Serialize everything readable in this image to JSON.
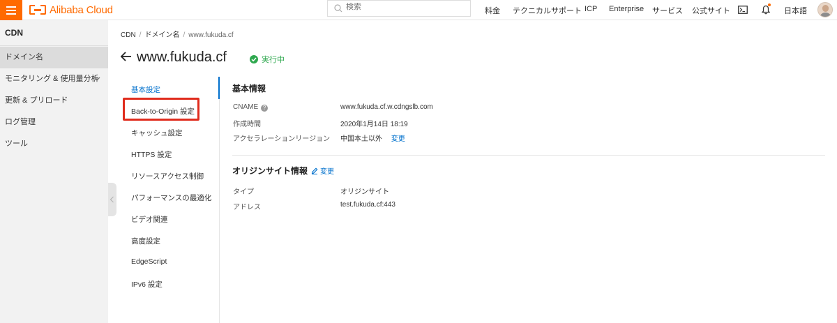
{
  "topbar": {
    "brand": "Alibaba Cloud",
    "search_placeholder": "検索",
    "nav": [
      "料金",
      "テクニカルサポート",
      "ICP",
      "Enterprise",
      "サービス",
      "公式サイト"
    ],
    "language": "日本語",
    "icons": [
      "menu-icon",
      "search-icon",
      "terminal-icon",
      "bell-icon",
      "avatar"
    ],
    "accent_color": "#ff6a00"
  },
  "sidebar": {
    "title": "CDN",
    "items": [
      {
        "label": "ドメイン名",
        "active": true
      },
      {
        "label": "モニタリング & 使用量分析",
        "expandable": true
      },
      {
        "label": "更新 & プリロード"
      },
      {
        "label": "ログ管理"
      },
      {
        "label": "ツール"
      }
    ]
  },
  "breadcrumb": [
    "CDN",
    "ドメイン名",
    "www.fukuda.cf"
  ],
  "page": {
    "title": "www.fukuda.cf",
    "status": "実行中",
    "status_color": "#2fa84f"
  },
  "subnav": {
    "tabs": [
      "基本設定",
      "Back-to-Origin 設定",
      "キャッシュ設定",
      "HTTPS 設定",
      "リソースアクセス制御",
      "パフォーマンスの最適化",
      "ビデオ関連",
      "高度設定",
      "EdgeScript",
      "IPv6 設定"
    ],
    "active_index": 0,
    "highlighted_index": 1,
    "highlight_color": "#e02c1d"
  },
  "basic_info": {
    "title": "基本情報",
    "cname_label": "CNAME",
    "cname_value": "www.fukuda.cf.w.cdngslb.com",
    "created_label": "作成時間",
    "created_value": "2020年1月14日 18:19",
    "region_label": "アクセラレーションリージョン",
    "region_value": "中国本土以外",
    "region_edit": "変更"
  },
  "origin_info": {
    "title": "オリジンサイト情報",
    "edit_label": "変更",
    "type_label": "タイプ",
    "type_value": "オリジンサイト",
    "address_label": "アドレス",
    "address_value": "test.fukuda.cf:443"
  },
  "link_color": "#0070cc"
}
